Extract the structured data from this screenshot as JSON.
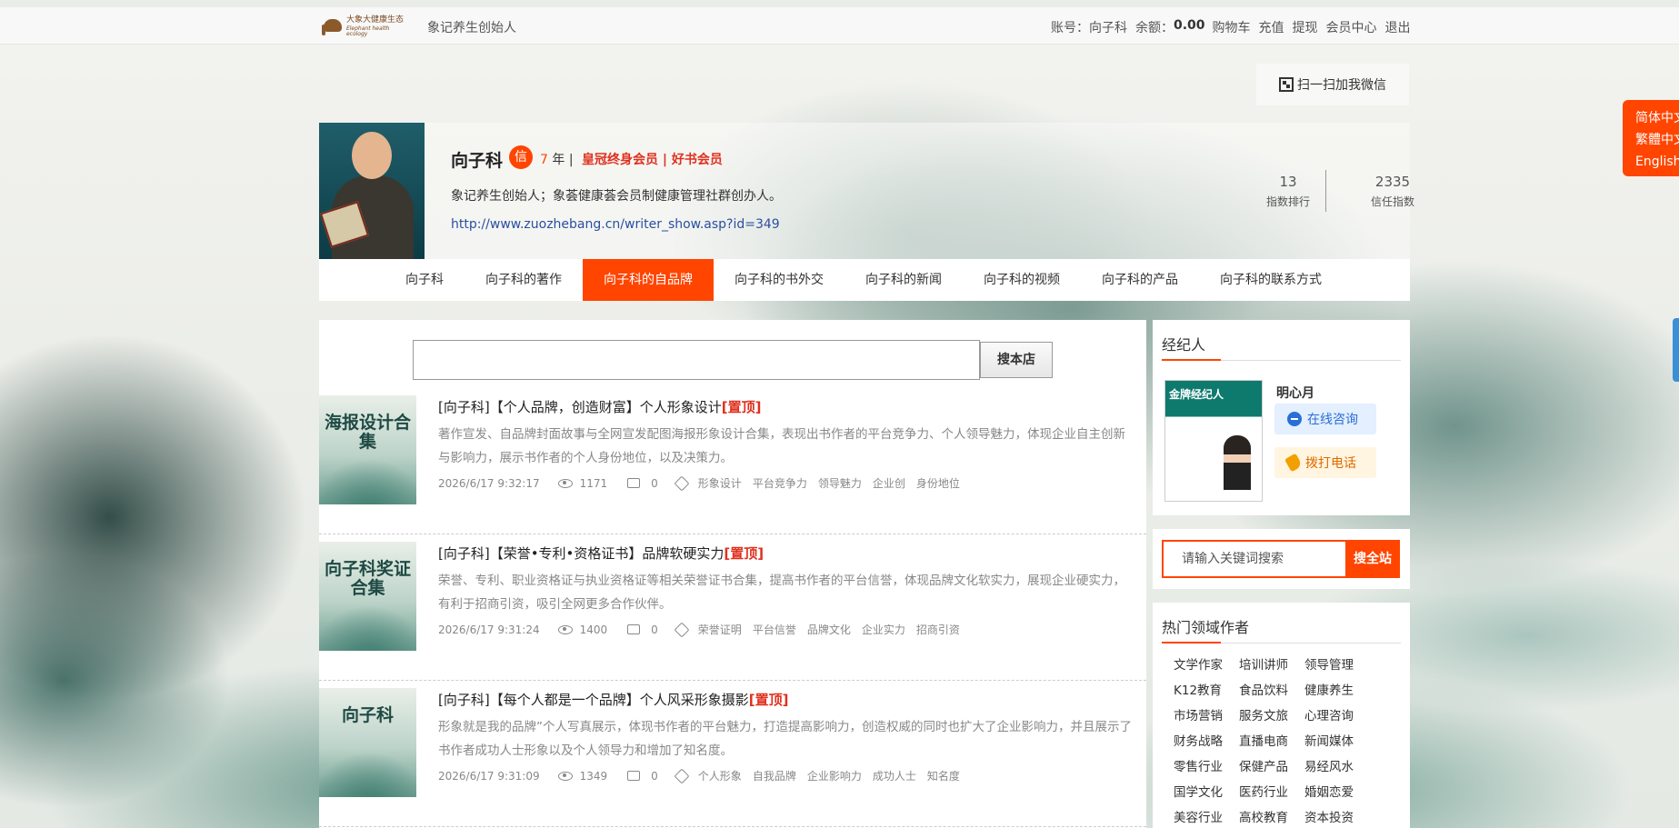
{
  "topbar": {
    "logo_cn": "大象大健康生态",
    "logo_en": "Elephant health ecology",
    "founder": "象记养生创始人",
    "account_label": "账号：",
    "account_name": "向子科",
    "balance_label": "余额：",
    "balance": "0.00",
    "links": [
      "购物车",
      "充值",
      "提现",
      "会员中心",
      "退出"
    ]
  },
  "qr": {
    "label": "扫一扫加我微信"
  },
  "lang": [
    "简体中文",
    "繁體中文",
    "English"
  ],
  "profile": {
    "name": "向子科",
    "badge": "信",
    "years_num": "7",
    "years_unit": " 年 |",
    "member": "皇冠终身会员 | 好书会员",
    "desc": "象记养生创始人；象荟健康荟会员制健康管理社群创办人。",
    "url": "http://www.zuozhebang.cn/writer_show.asp?id=349",
    "rank_value": "13",
    "rank_label": "指数排行",
    "trust_value": "2335",
    "trust_label": "信任指数"
  },
  "nav": {
    "tabs": [
      "向子科",
      "向子科的著作",
      "向子科的自品牌",
      "向子科的书外交",
      "向子科的新闻",
      "向子科的视频",
      "向子科的产品",
      "向子科的联系方式"
    ],
    "active": 2
  },
  "search": {
    "button": "搜本店"
  },
  "items": [
    {
      "thumb_text": "海报设计合集",
      "title": "[向子科]【个人品牌，创造财富】个人形象设计",
      "top": "[置顶]",
      "desc": "著作宣发、自品牌封面故事与全网宣发配图海报形象设计合集，表现出书作者的平台竞争力、个人领导魅力，体现企业自主创新与影响力，展示书作者的个人身份地位，以及决策力。",
      "date": "2026/6/17 9:32:17",
      "views": "1171",
      "comments": "0",
      "tags": [
        "形象设计",
        "平台竞争力",
        "领导魅力",
        "企业创",
        "身份地位"
      ]
    },
    {
      "thumb_text": "向子科奖证合集",
      "title": "[向子科]【荣誉•专利•资格证书】品牌软硬实力",
      "top": "[置顶]",
      "desc": "荣誉、专利、职业资格证与执业资格证等相关荣誉证书合集，提高书作者的平台信誉，体现品牌文化软实力，展现企业硬实力，有利于招商引资，吸引全网更多合作伙伴。",
      "date": "2026/6/17 9:31:24",
      "views": "1400",
      "comments": "0",
      "tags": [
        "荣誉证明",
        "平台信誉",
        "品牌文化",
        "企业实力",
        "招商引资"
      ]
    },
    {
      "thumb_text": "向子科",
      "title": "[向子科]【每个人都是一个品牌】个人风采形象摄影",
      "top": "[置顶]",
      "desc": "形象就是我的品牌”个人写真展示，体现书作者的平台魅力，打造提高影响力，创造权威的同时也扩大了企业影响力，并且展示了书作者成功人士形象以及个人领导力和增加了知名度。",
      "date": "2026/6/17 9:31:09",
      "views": "1349",
      "comments": "0",
      "tags": [
        "个人形象",
        "自我品牌",
        "企业影响力",
        "成功人士",
        "知名度"
      ]
    }
  ],
  "agent": {
    "title": "经纪人",
    "cover_text": "金牌经纪人",
    "name": "明心月",
    "consult": "在线咨询",
    "call": "拨打电话"
  },
  "site_search": {
    "placeholder": "请输入关键词搜索",
    "button": "搜全站"
  },
  "hot": {
    "title": "热门领域作者",
    "items": [
      "文学作家",
      "培训讲师",
      "领导管理",
      "K12教育",
      "食品饮料",
      "健康养生",
      "市场营销",
      "服务文旅",
      "心理咨询",
      "财务战略",
      "直播电商",
      "新闻媒体",
      "零售行业",
      "保健产品",
      "易经风水",
      "国学文化",
      "医药行业",
      "婚姻恋爱",
      "美容行业",
      "高校教育",
      "资本投资"
    ]
  }
}
